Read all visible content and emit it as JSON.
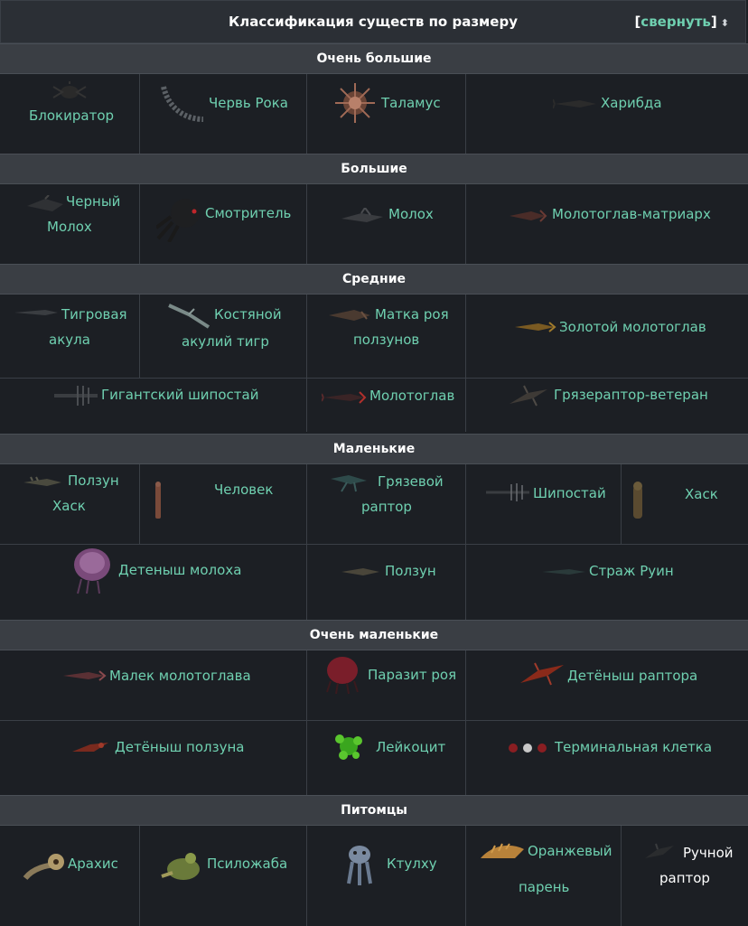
{
  "title": "Классификация существ по размеру",
  "toggle": {
    "open": "[",
    "label": "свернуть",
    "close": "]",
    "arrows": "⬍"
  },
  "groups": [
    "Очень большие",
    "Большие",
    "Средние",
    "Маленькие",
    "Очень маленькие",
    "Питомцы"
  ],
  "creatures": {
    "blokirator": "Блокиратор",
    "cherv_roka": "Червь Рока",
    "talamus": "Таламус",
    "kharibda": "Харибда",
    "cherny_molokh_1": "Черный",
    "cherny_molokh_2": "Молох",
    "smotritel": "Смотритель",
    "molokh": "Молох",
    "molotoglav_matriarkh": "Молотоглав-матриарх",
    "tigrovaya_1": "Тигровая",
    "tigrovaya_2": "акула",
    "kostyanoy_1": "Костяной",
    "kostyanoy_2": "акулий тигр",
    "matka_1": "Матка роя",
    "matka_2": "ползунов",
    "zolotoy": "Золотой молотоглав",
    "gigantsky": "Гигантский шипостай",
    "molotoglav": "Молотоглав",
    "gryazeraptor_veteran": "Грязераптор-ветеран",
    "polzun_khask_1": "Ползун",
    "polzun_khask_2": "Хаск",
    "chelovek": "Человек",
    "gryazevoy_1": "Грязевой",
    "gryazevoy_2": "раптор",
    "shipostay": "Шипостай",
    "khask": "Хаск",
    "detenysh_molokha": "Детеныш молоха",
    "polzun": "Ползун",
    "strazh_ruin": "Страж Руин",
    "malek": "Малек молотоглава",
    "parazit": "Паразит роя",
    "detenysh_raptora": "Детёныш раптора",
    "detenysh_polzuna": "Детёныш ползуна",
    "leykotsit": "Лейкоцит",
    "terminalnaya": "Терминальная клетка",
    "arakhis": "Арахис",
    "psilozhaba": "Псиложаба",
    "ktulkhu": "Ктулху",
    "oranzhevy_1": "Оранжевый",
    "oranzhevy_2": "парень",
    "ruchnoy_1": "Ручной",
    "ruchnoy_2": "раптор"
  }
}
